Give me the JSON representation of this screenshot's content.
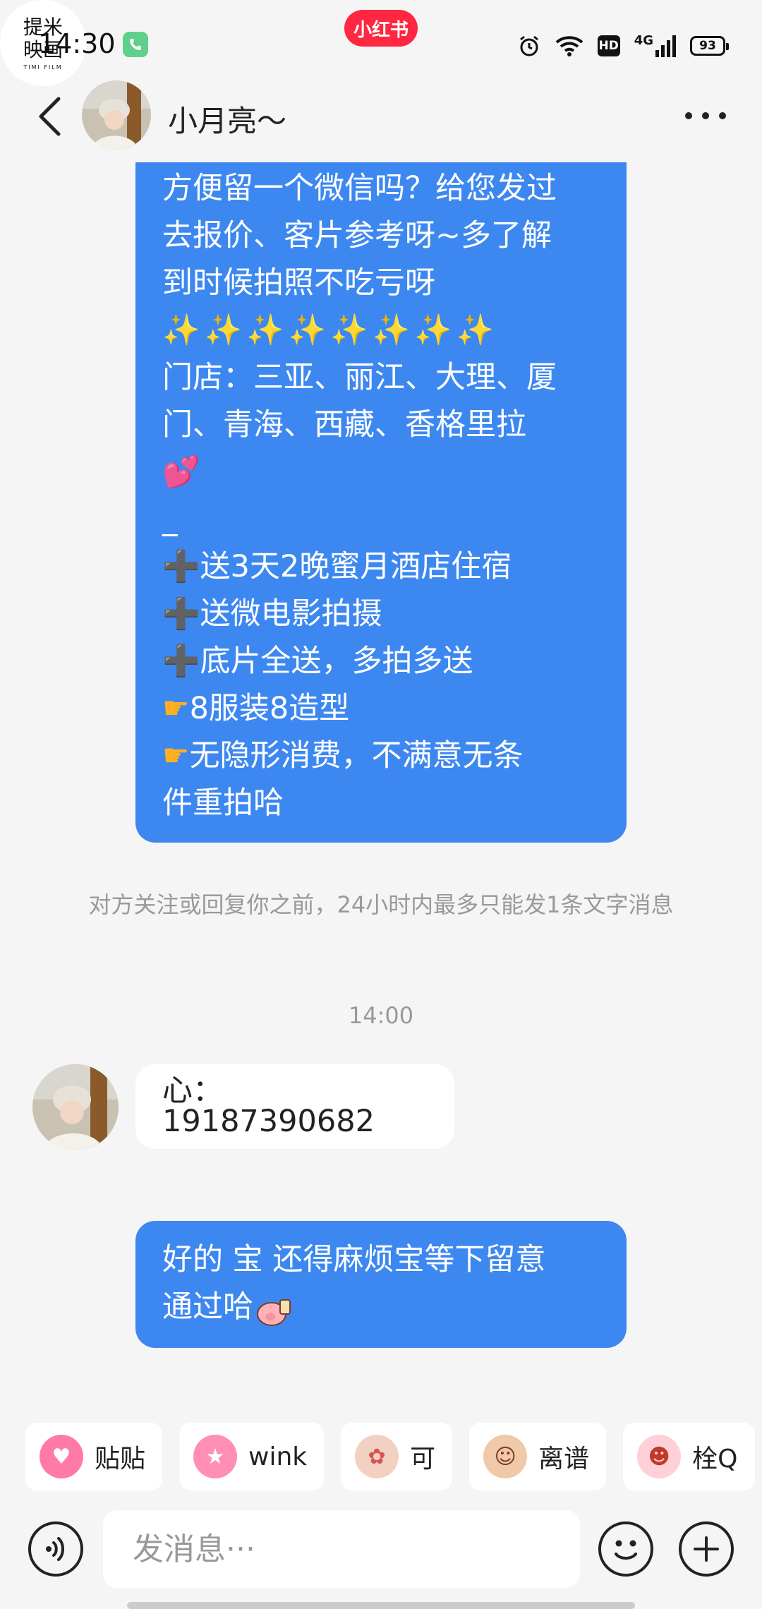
{
  "status_bar": {
    "time": "14:30",
    "brand": "小红书",
    "network": "4G",
    "hd": "HD",
    "battery": "93"
  },
  "header": {
    "contact_name": "小月亮～"
  },
  "messages": {
    "quote": {
      "line1": "方便留一个微信吗？给您发过",
      "line2": "去报价、客片参考呀~多了解",
      "line3": "到时候拍照不吃亏呀",
      "sparkles": "✨✨✨✨✨✨✨✨",
      "line4": "门店：三亚、丽江、大理、厦",
      "line5": "门、青海、西藏、香格里拉",
      "heart": "💕",
      "dash": "_",
      "plus1": "送3天2晚蜜月酒店住宿",
      "plus2": "送微电影拍摄",
      "plus3": "底片全送，多拍多送",
      "point1": "8服装8造型",
      "point2a": "无隐形消费，不满意无条",
      "point2b": "件重拍哈"
    },
    "system_note": "对方关注或回复你之前，24小时内最多只能发1条文字消息",
    "time_sep": "14:00",
    "phone_msg": "心：19187390682",
    "reply_line1": "好的  宝 还得麻烦宝等下留意",
    "reply_line2": "通过哈",
    "my_avatar_text_top": "提米",
    "my_avatar_text_bottom": "映画",
    "my_avatar_sub": "TIMI FILM"
  },
  "stickers": [
    {
      "label": "贴贴",
      "color": "#ff7aa8",
      "glyph": "♥"
    },
    {
      "label": "wink",
      "color": "#ff8fb6",
      "glyph": "★"
    },
    {
      "label": "可",
      "color": "#f3d1c2",
      "glyph": "✿"
    },
    {
      "label": "离谱",
      "color": "#f0c9a8",
      "glyph": "☺"
    },
    {
      "label": "栓Q",
      "color": "#ffd0d8",
      "glyph": "☻"
    }
  ],
  "input": {
    "placeholder": "发消息···"
  },
  "colors": {
    "bubble_blue": "#3d88f0",
    "brand_red": "#ff2741"
  }
}
